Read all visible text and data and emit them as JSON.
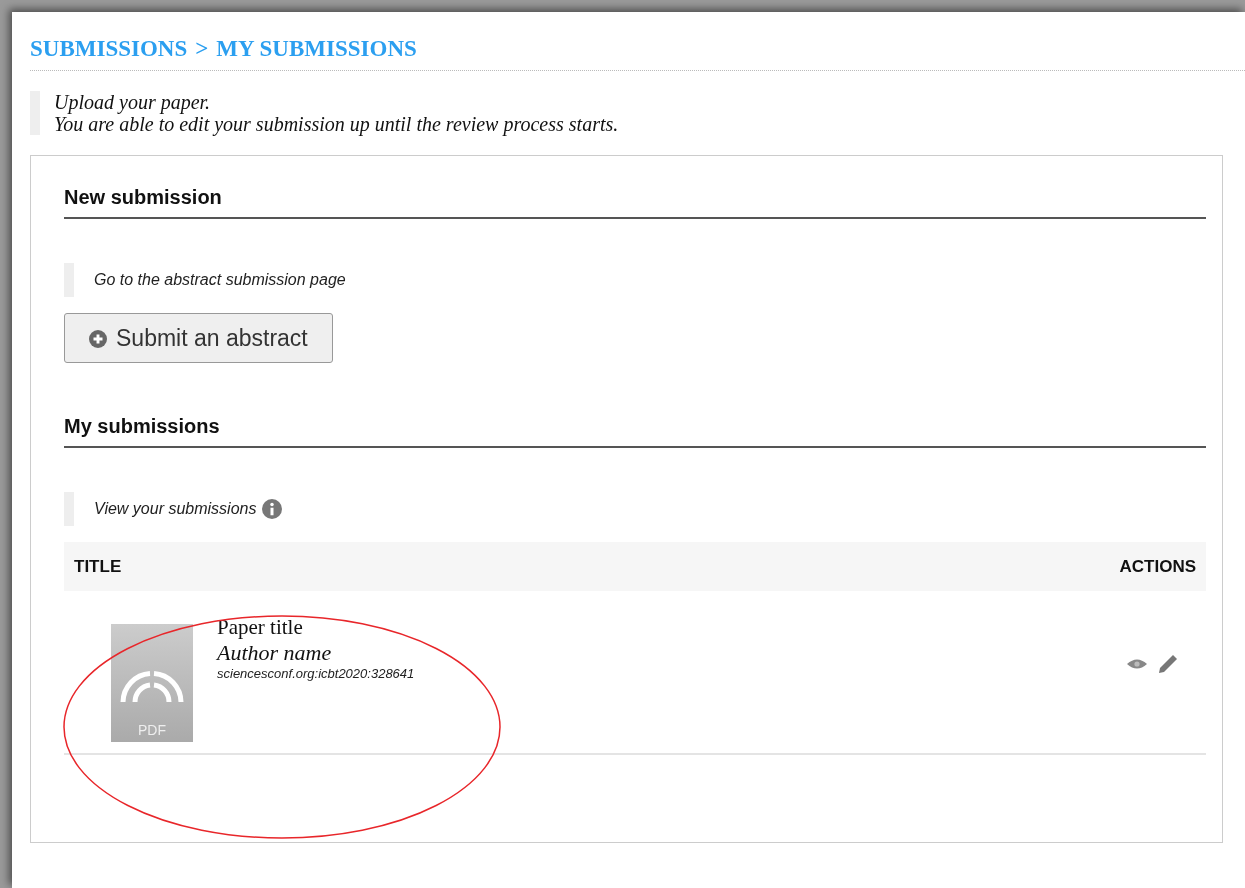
{
  "breadcrumb": {
    "items": [
      "SUBMISSIONS",
      "MY SUBMISSIONS"
    ],
    "separator": ">"
  },
  "intro": [
    "Upload your paper.",
    "You are able to edit your submission up until the review process starts."
  ],
  "new_submission": {
    "heading": "New submission",
    "hint": "Go to the abstract submission page",
    "button": "Submit an abstract"
  },
  "my_submissions": {
    "heading": "My submissions",
    "hint": "View your submissions",
    "table": {
      "columns": [
        "TITLE",
        "ACTIONS"
      ],
      "rows": [
        {
          "file_type": "PDF",
          "title": "Paper title",
          "author": "Author name",
          "id": "sciencesconf.org:icbt2020:328641"
        }
      ]
    }
  },
  "annotation": {
    "kind": "ellipse"
  }
}
